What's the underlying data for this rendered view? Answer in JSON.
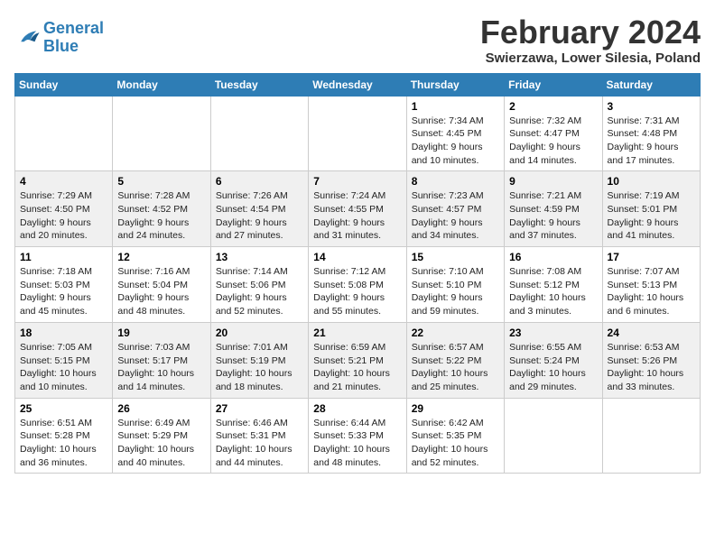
{
  "logo": {
    "line1": "General",
    "line2": "Blue"
  },
  "title": "February 2024",
  "location": "Swierzawa, Lower Silesia, Poland",
  "weekdays": [
    "Sunday",
    "Monday",
    "Tuesday",
    "Wednesday",
    "Thursday",
    "Friday",
    "Saturday"
  ],
  "weeks": [
    [
      {
        "day": "",
        "info": ""
      },
      {
        "day": "",
        "info": ""
      },
      {
        "day": "",
        "info": ""
      },
      {
        "day": "",
        "info": ""
      },
      {
        "day": "1",
        "info": "Sunrise: 7:34 AM\nSunset: 4:45 PM\nDaylight: 9 hours\nand 10 minutes."
      },
      {
        "day": "2",
        "info": "Sunrise: 7:32 AM\nSunset: 4:47 PM\nDaylight: 9 hours\nand 14 minutes."
      },
      {
        "day": "3",
        "info": "Sunrise: 7:31 AM\nSunset: 4:48 PM\nDaylight: 9 hours\nand 17 minutes."
      }
    ],
    [
      {
        "day": "4",
        "info": "Sunrise: 7:29 AM\nSunset: 4:50 PM\nDaylight: 9 hours\nand 20 minutes."
      },
      {
        "day": "5",
        "info": "Sunrise: 7:28 AM\nSunset: 4:52 PM\nDaylight: 9 hours\nand 24 minutes."
      },
      {
        "day": "6",
        "info": "Sunrise: 7:26 AM\nSunset: 4:54 PM\nDaylight: 9 hours\nand 27 minutes."
      },
      {
        "day": "7",
        "info": "Sunrise: 7:24 AM\nSunset: 4:55 PM\nDaylight: 9 hours\nand 31 minutes."
      },
      {
        "day": "8",
        "info": "Sunrise: 7:23 AM\nSunset: 4:57 PM\nDaylight: 9 hours\nand 34 minutes."
      },
      {
        "day": "9",
        "info": "Sunrise: 7:21 AM\nSunset: 4:59 PM\nDaylight: 9 hours\nand 37 minutes."
      },
      {
        "day": "10",
        "info": "Sunrise: 7:19 AM\nSunset: 5:01 PM\nDaylight: 9 hours\nand 41 minutes."
      }
    ],
    [
      {
        "day": "11",
        "info": "Sunrise: 7:18 AM\nSunset: 5:03 PM\nDaylight: 9 hours\nand 45 minutes."
      },
      {
        "day": "12",
        "info": "Sunrise: 7:16 AM\nSunset: 5:04 PM\nDaylight: 9 hours\nand 48 minutes."
      },
      {
        "day": "13",
        "info": "Sunrise: 7:14 AM\nSunset: 5:06 PM\nDaylight: 9 hours\nand 52 minutes."
      },
      {
        "day": "14",
        "info": "Sunrise: 7:12 AM\nSunset: 5:08 PM\nDaylight: 9 hours\nand 55 minutes."
      },
      {
        "day": "15",
        "info": "Sunrise: 7:10 AM\nSunset: 5:10 PM\nDaylight: 9 hours\nand 59 minutes."
      },
      {
        "day": "16",
        "info": "Sunrise: 7:08 AM\nSunset: 5:12 PM\nDaylight: 10 hours\nand 3 minutes."
      },
      {
        "day": "17",
        "info": "Sunrise: 7:07 AM\nSunset: 5:13 PM\nDaylight: 10 hours\nand 6 minutes."
      }
    ],
    [
      {
        "day": "18",
        "info": "Sunrise: 7:05 AM\nSunset: 5:15 PM\nDaylight: 10 hours\nand 10 minutes."
      },
      {
        "day": "19",
        "info": "Sunrise: 7:03 AM\nSunset: 5:17 PM\nDaylight: 10 hours\nand 14 minutes."
      },
      {
        "day": "20",
        "info": "Sunrise: 7:01 AM\nSunset: 5:19 PM\nDaylight: 10 hours\nand 18 minutes."
      },
      {
        "day": "21",
        "info": "Sunrise: 6:59 AM\nSunset: 5:21 PM\nDaylight: 10 hours\nand 21 minutes."
      },
      {
        "day": "22",
        "info": "Sunrise: 6:57 AM\nSunset: 5:22 PM\nDaylight: 10 hours\nand 25 minutes."
      },
      {
        "day": "23",
        "info": "Sunrise: 6:55 AM\nSunset: 5:24 PM\nDaylight: 10 hours\nand 29 minutes."
      },
      {
        "day": "24",
        "info": "Sunrise: 6:53 AM\nSunset: 5:26 PM\nDaylight: 10 hours\nand 33 minutes."
      }
    ],
    [
      {
        "day": "25",
        "info": "Sunrise: 6:51 AM\nSunset: 5:28 PM\nDaylight: 10 hours\nand 36 minutes."
      },
      {
        "day": "26",
        "info": "Sunrise: 6:49 AM\nSunset: 5:29 PM\nDaylight: 10 hours\nand 40 minutes."
      },
      {
        "day": "27",
        "info": "Sunrise: 6:46 AM\nSunset: 5:31 PM\nDaylight: 10 hours\nand 44 minutes."
      },
      {
        "day": "28",
        "info": "Sunrise: 6:44 AM\nSunset: 5:33 PM\nDaylight: 10 hours\nand 48 minutes."
      },
      {
        "day": "29",
        "info": "Sunrise: 6:42 AM\nSunset: 5:35 PM\nDaylight: 10 hours\nand 52 minutes."
      },
      {
        "day": "",
        "info": ""
      },
      {
        "day": "",
        "info": ""
      }
    ]
  ]
}
